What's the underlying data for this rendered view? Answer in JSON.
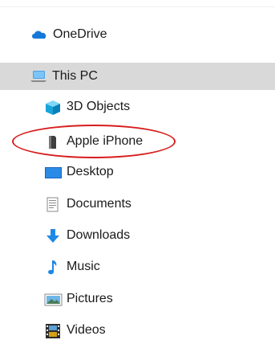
{
  "nav": {
    "items": [
      {
        "label": "OneDrive",
        "icon": "cloud-icon"
      },
      {
        "label": "This PC",
        "icon": "computer-icon",
        "selected": true
      },
      {
        "label": "3D Objects",
        "icon": "cube-icon"
      },
      {
        "label": "Apple iPhone",
        "icon": "phone-icon"
      },
      {
        "label": "Desktop",
        "icon": "desktop-icon"
      },
      {
        "label": "Documents",
        "icon": "document-icon"
      },
      {
        "label": "Downloads",
        "icon": "download-icon"
      },
      {
        "label": "Music",
        "icon": "music-note-icon"
      },
      {
        "label": "Pictures",
        "icon": "picture-icon"
      },
      {
        "label": "Videos",
        "icon": "film-icon"
      }
    ]
  },
  "colors": {
    "selected_bg": "#d9d9d9",
    "highlight_ring": "#d81e1e",
    "accent_blue": "#1e88e5"
  }
}
